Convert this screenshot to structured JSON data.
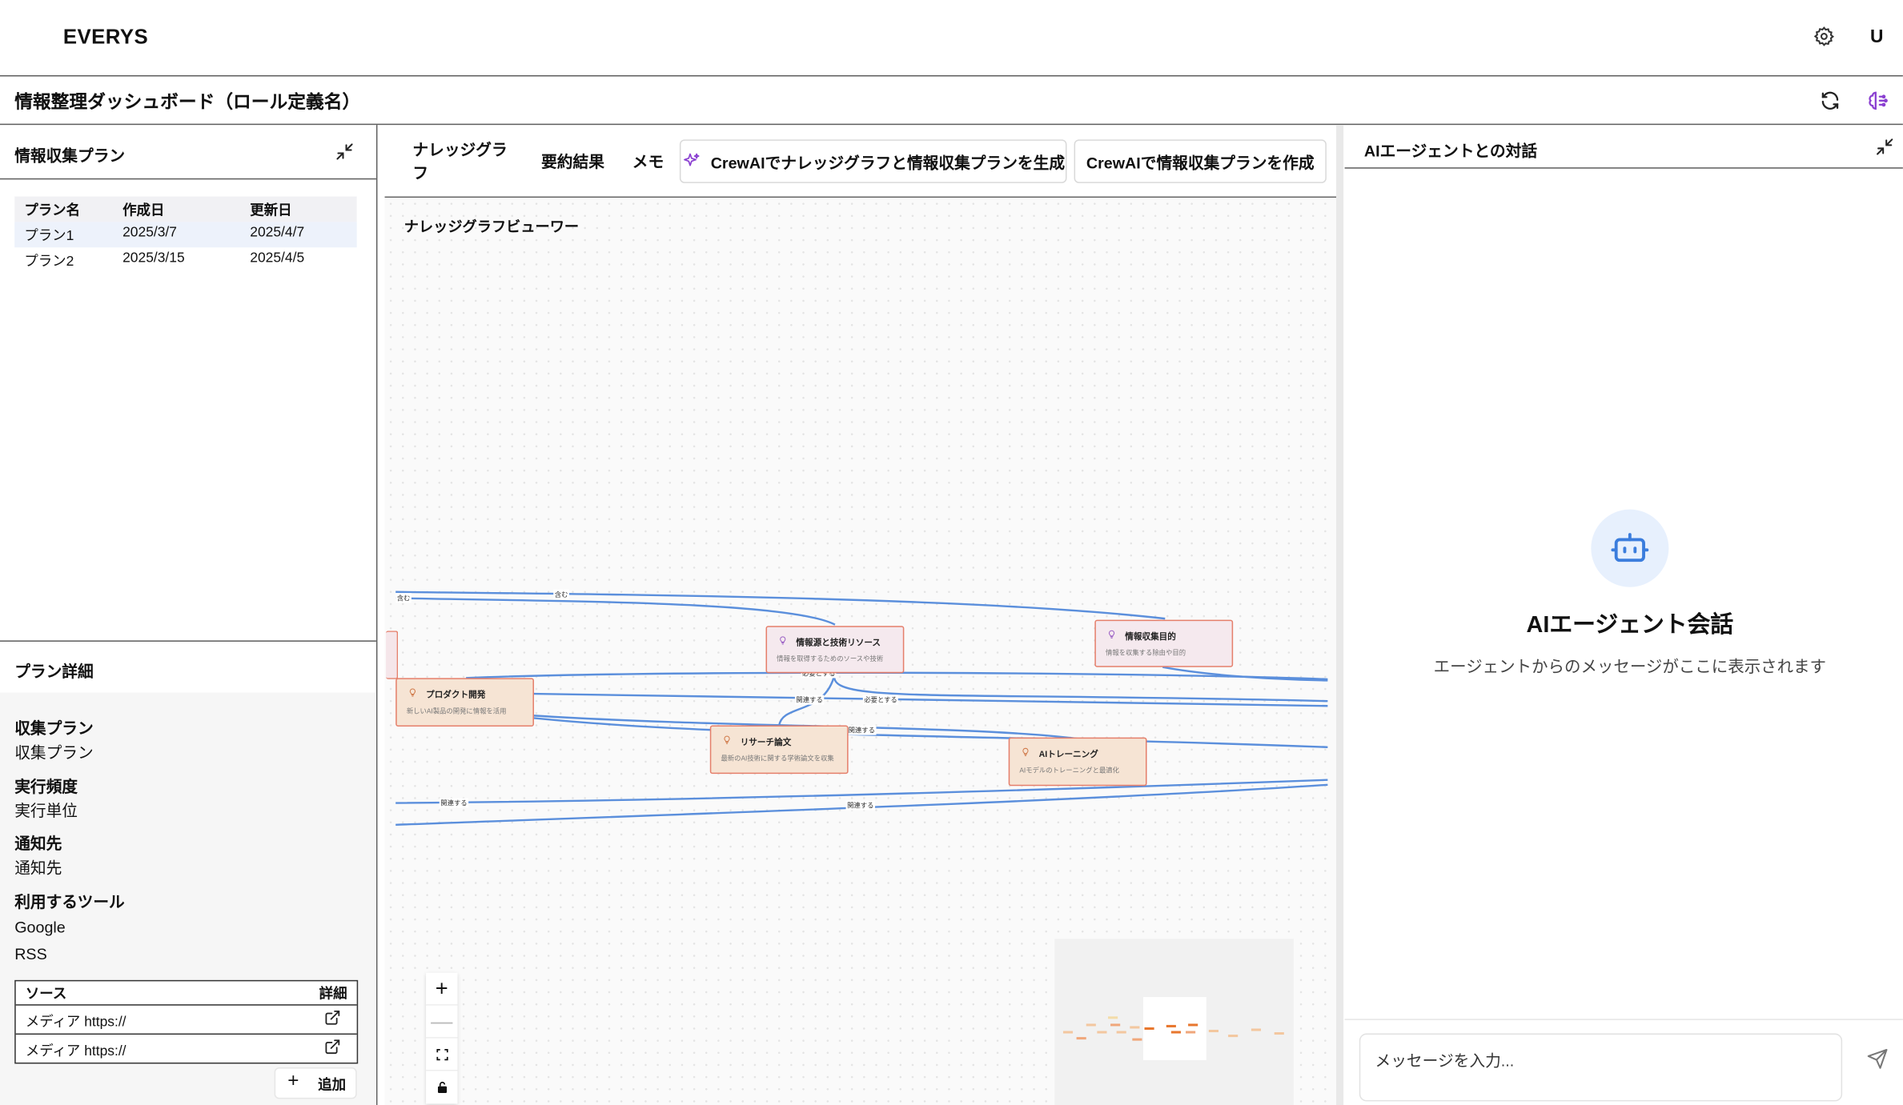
{
  "app": {
    "brand": "EVERYS",
    "user_initial": "U"
  },
  "page": {
    "title": "情報整理ダッシュボード（ロール定義名）"
  },
  "plan_list": {
    "title": "情報収集プラン",
    "columns": [
      "プラン名",
      "作成日",
      "更新日"
    ],
    "rows": [
      [
        "プラン1",
        "2025/3/7",
        "2025/4/7"
      ],
      [
        "プラン2",
        "2025/3/15",
        "2025/4/5"
      ]
    ]
  },
  "plan_detail": {
    "title": "プラン詳細",
    "collect_label": "収集プラン",
    "collect_value": "収集プラン",
    "freq_label": "実行頻度",
    "freq_value": "実行単位",
    "notify_label": "通知先",
    "notify_value": "通知先",
    "tools_label": "利用するツール",
    "tools": [
      "Google",
      "RSS"
    ],
    "sources_header": [
      "ソース",
      "詳細"
    ],
    "sources": [
      "メディア https://",
      "メディア https://"
    ],
    "add_label": "追加"
  },
  "tabs": [
    {
      "label": "ナレッジグラフ"
    },
    {
      "label": "要約結果"
    },
    {
      "label": "メモ"
    },
    {
      "label": "CrewAIでナレッジグラフと情報収集プランを生成"
    },
    {
      "label": "CrewAIで情報収集プランを作成"
    }
  ],
  "graph": {
    "viewer_title": "ナレッジグラフビューワー",
    "nodes": [
      {
        "title": "情報源と技術リソース",
        "desc": "情報を取得するためのソースや技術"
      },
      {
        "title": "情報収集目的",
        "desc": "情報を収集する除由や目的"
      },
      {
        "title": "プロダクト開発",
        "desc": "新しいAI製品の開発に情報を活用"
      },
      {
        "title": "リサーチ論文",
        "desc": "最新のAI技術に関する学術論文を収集"
      },
      {
        "title": "AIトレーニング",
        "desc": "AIモデルのトレーニングと最適化"
      }
    ],
    "edge_labels": [
      "含む",
      "含む",
      "関連する",
      "必要とする",
      "関連する",
      "関連する",
      "関連する",
      "必要とする"
    ]
  },
  "chat": {
    "title": "AIエージェントとの対話",
    "empty_title": "AIエージェント会話",
    "empty_sub": "エージェントからのメッセージがここに表示されます",
    "input_placeholder": "メッセージを入力..."
  },
  "colors": {
    "accent": "#3b7ddd",
    "node_border": "#e57f6b",
    "bot_bg": "#e7f0fd",
    "sparkle": "#8a3fd1"
  }
}
